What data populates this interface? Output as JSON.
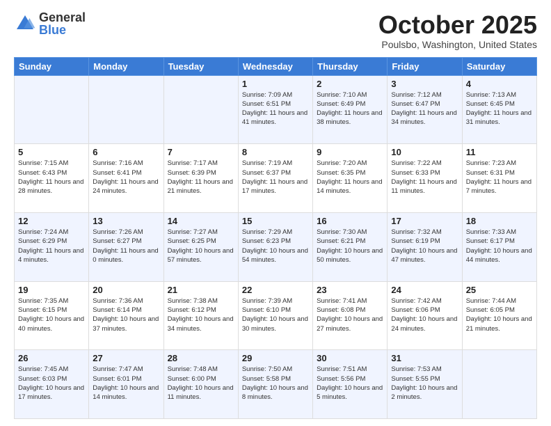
{
  "logo": {
    "general": "General",
    "blue": "Blue"
  },
  "title": "October 2025",
  "location": "Poulsbo, Washington, United States",
  "days_of_week": [
    "Sunday",
    "Monday",
    "Tuesday",
    "Wednesday",
    "Thursday",
    "Friday",
    "Saturday"
  ],
  "weeks": [
    [
      {
        "day": "",
        "sunrise": "",
        "sunset": "",
        "daylight": ""
      },
      {
        "day": "",
        "sunrise": "",
        "sunset": "",
        "daylight": ""
      },
      {
        "day": "",
        "sunrise": "",
        "sunset": "",
        "daylight": ""
      },
      {
        "day": "1",
        "sunrise": "Sunrise: 7:09 AM",
        "sunset": "Sunset: 6:51 PM",
        "daylight": "Daylight: 11 hours and 41 minutes."
      },
      {
        "day": "2",
        "sunrise": "Sunrise: 7:10 AM",
        "sunset": "Sunset: 6:49 PM",
        "daylight": "Daylight: 11 hours and 38 minutes."
      },
      {
        "day": "3",
        "sunrise": "Sunrise: 7:12 AM",
        "sunset": "Sunset: 6:47 PM",
        "daylight": "Daylight: 11 hours and 34 minutes."
      },
      {
        "day": "4",
        "sunrise": "Sunrise: 7:13 AM",
        "sunset": "Sunset: 6:45 PM",
        "daylight": "Daylight: 11 hours and 31 minutes."
      }
    ],
    [
      {
        "day": "5",
        "sunrise": "Sunrise: 7:15 AM",
        "sunset": "Sunset: 6:43 PM",
        "daylight": "Daylight: 11 hours and 28 minutes."
      },
      {
        "day": "6",
        "sunrise": "Sunrise: 7:16 AM",
        "sunset": "Sunset: 6:41 PM",
        "daylight": "Daylight: 11 hours and 24 minutes."
      },
      {
        "day": "7",
        "sunrise": "Sunrise: 7:17 AM",
        "sunset": "Sunset: 6:39 PM",
        "daylight": "Daylight: 11 hours and 21 minutes."
      },
      {
        "day": "8",
        "sunrise": "Sunrise: 7:19 AM",
        "sunset": "Sunset: 6:37 PM",
        "daylight": "Daylight: 11 hours and 17 minutes."
      },
      {
        "day": "9",
        "sunrise": "Sunrise: 7:20 AM",
        "sunset": "Sunset: 6:35 PM",
        "daylight": "Daylight: 11 hours and 14 minutes."
      },
      {
        "day": "10",
        "sunrise": "Sunrise: 7:22 AM",
        "sunset": "Sunset: 6:33 PM",
        "daylight": "Daylight: 11 hours and 11 minutes."
      },
      {
        "day": "11",
        "sunrise": "Sunrise: 7:23 AM",
        "sunset": "Sunset: 6:31 PM",
        "daylight": "Daylight: 11 hours and 7 minutes."
      }
    ],
    [
      {
        "day": "12",
        "sunrise": "Sunrise: 7:24 AM",
        "sunset": "Sunset: 6:29 PM",
        "daylight": "Daylight: 11 hours and 4 minutes."
      },
      {
        "day": "13",
        "sunrise": "Sunrise: 7:26 AM",
        "sunset": "Sunset: 6:27 PM",
        "daylight": "Daylight: 11 hours and 0 minutes."
      },
      {
        "day": "14",
        "sunrise": "Sunrise: 7:27 AM",
        "sunset": "Sunset: 6:25 PM",
        "daylight": "Daylight: 10 hours and 57 minutes."
      },
      {
        "day": "15",
        "sunrise": "Sunrise: 7:29 AM",
        "sunset": "Sunset: 6:23 PM",
        "daylight": "Daylight: 10 hours and 54 minutes."
      },
      {
        "day": "16",
        "sunrise": "Sunrise: 7:30 AM",
        "sunset": "Sunset: 6:21 PM",
        "daylight": "Daylight: 10 hours and 50 minutes."
      },
      {
        "day": "17",
        "sunrise": "Sunrise: 7:32 AM",
        "sunset": "Sunset: 6:19 PM",
        "daylight": "Daylight: 10 hours and 47 minutes."
      },
      {
        "day": "18",
        "sunrise": "Sunrise: 7:33 AM",
        "sunset": "Sunset: 6:17 PM",
        "daylight": "Daylight: 10 hours and 44 minutes."
      }
    ],
    [
      {
        "day": "19",
        "sunrise": "Sunrise: 7:35 AM",
        "sunset": "Sunset: 6:15 PM",
        "daylight": "Daylight: 10 hours and 40 minutes."
      },
      {
        "day": "20",
        "sunrise": "Sunrise: 7:36 AM",
        "sunset": "Sunset: 6:14 PM",
        "daylight": "Daylight: 10 hours and 37 minutes."
      },
      {
        "day": "21",
        "sunrise": "Sunrise: 7:38 AM",
        "sunset": "Sunset: 6:12 PM",
        "daylight": "Daylight: 10 hours and 34 minutes."
      },
      {
        "day": "22",
        "sunrise": "Sunrise: 7:39 AM",
        "sunset": "Sunset: 6:10 PM",
        "daylight": "Daylight: 10 hours and 30 minutes."
      },
      {
        "day": "23",
        "sunrise": "Sunrise: 7:41 AM",
        "sunset": "Sunset: 6:08 PM",
        "daylight": "Daylight: 10 hours and 27 minutes."
      },
      {
        "day": "24",
        "sunrise": "Sunrise: 7:42 AM",
        "sunset": "Sunset: 6:06 PM",
        "daylight": "Daylight: 10 hours and 24 minutes."
      },
      {
        "day": "25",
        "sunrise": "Sunrise: 7:44 AM",
        "sunset": "Sunset: 6:05 PM",
        "daylight": "Daylight: 10 hours and 21 minutes."
      }
    ],
    [
      {
        "day": "26",
        "sunrise": "Sunrise: 7:45 AM",
        "sunset": "Sunset: 6:03 PM",
        "daylight": "Daylight: 10 hours and 17 minutes."
      },
      {
        "day": "27",
        "sunrise": "Sunrise: 7:47 AM",
        "sunset": "Sunset: 6:01 PM",
        "daylight": "Daylight: 10 hours and 14 minutes."
      },
      {
        "day": "28",
        "sunrise": "Sunrise: 7:48 AM",
        "sunset": "Sunset: 6:00 PM",
        "daylight": "Daylight: 10 hours and 11 minutes."
      },
      {
        "day": "29",
        "sunrise": "Sunrise: 7:50 AM",
        "sunset": "Sunset: 5:58 PM",
        "daylight": "Daylight: 10 hours and 8 minutes."
      },
      {
        "day": "30",
        "sunrise": "Sunrise: 7:51 AM",
        "sunset": "Sunset: 5:56 PM",
        "daylight": "Daylight: 10 hours and 5 minutes."
      },
      {
        "day": "31",
        "sunrise": "Sunrise: 7:53 AM",
        "sunset": "Sunset: 5:55 PM",
        "daylight": "Daylight: 10 hours and 2 minutes."
      },
      {
        "day": "",
        "sunrise": "",
        "sunset": "",
        "daylight": ""
      }
    ]
  ]
}
